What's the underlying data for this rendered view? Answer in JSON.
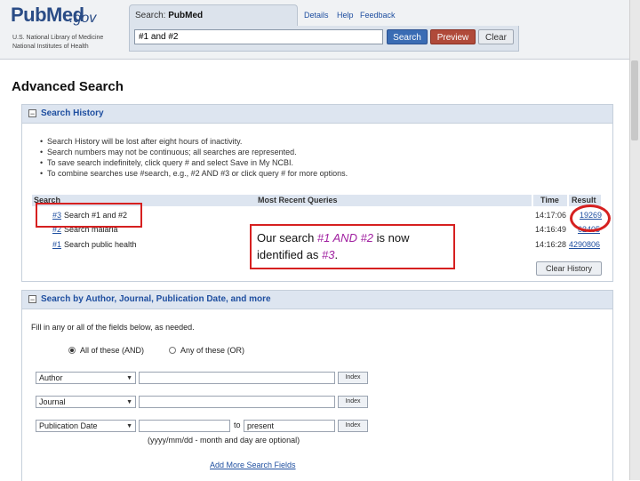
{
  "header": {
    "logo_pub": "PubMed",
    "logo_gov": ".gov",
    "org_line1": "U.S. National Library of Medicine",
    "org_line2": "National Institutes of Health",
    "search_label_prefix": "Search:",
    "search_label_db": "PubMed",
    "search_value": "#1 and #2",
    "search_button": "Search",
    "preview_button": "Preview",
    "clear_button": "Clear",
    "links": [
      "Details",
      "Help",
      "Feedback"
    ]
  },
  "page_title": "Advanced Search",
  "history": {
    "panel_title": "Search History",
    "bullets": [
      "Search History will be lost after eight hours of inactivity.",
      "Search numbers may not be continuous; all searches are represented.",
      "To save search indefinitely, click query # and select Save in My NCBI.",
      "To combine searches use #search, e.g., #2 AND #3 or click query # for more options."
    ],
    "columns": [
      "Search",
      "Most Recent Queries",
      "Time",
      "Result"
    ],
    "rows": [
      {
        "num": "#3",
        "query": "Search #1 and #2",
        "time": "14:17:06",
        "result": "19269"
      },
      {
        "num": "#2",
        "query": "Search malaria",
        "time": "14:16:49",
        "result": "62405"
      },
      {
        "num": "#1",
        "query": "Search public health",
        "time": "14:16:28",
        "result": "4290806"
      }
    ],
    "clear_history_button": "Clear History"
  },
  "callout": {
    "part1": "Our search ",
    "em": "#1 AND #2",
    "part2": " is now identified as ",
    "em2": "#3",
    "part3": "."
  },
  "author_search": {
    "panel_title": "Search by Author, Journal, Publication Date, and more",
    "instructions": "Fill in any or all of the fields below, as needed.",
    "radio_all": "All of these (AND)",
    "radio_any": "Any of these (OR)",
    "fields": [
      {
        "label": "Author",
        "index": "Index"
      },
      {
        "label": "Journal",
        "index": "Index"
      },
      {
        "label": "Publication Date",
        "index": "Index"
      }
    ],
    "date_to": "to",
    "date_end_value": "present",
    "date_hint": "(yyyy/mm/dd - month and day are optional)",
    "add_more_link": "Add More Search Fields"
  },
  "colors": {
    "accent": "#1f4fa0",
    "highlight": "#d62020",
    "callout_em": "#a020a0"
  }
}
